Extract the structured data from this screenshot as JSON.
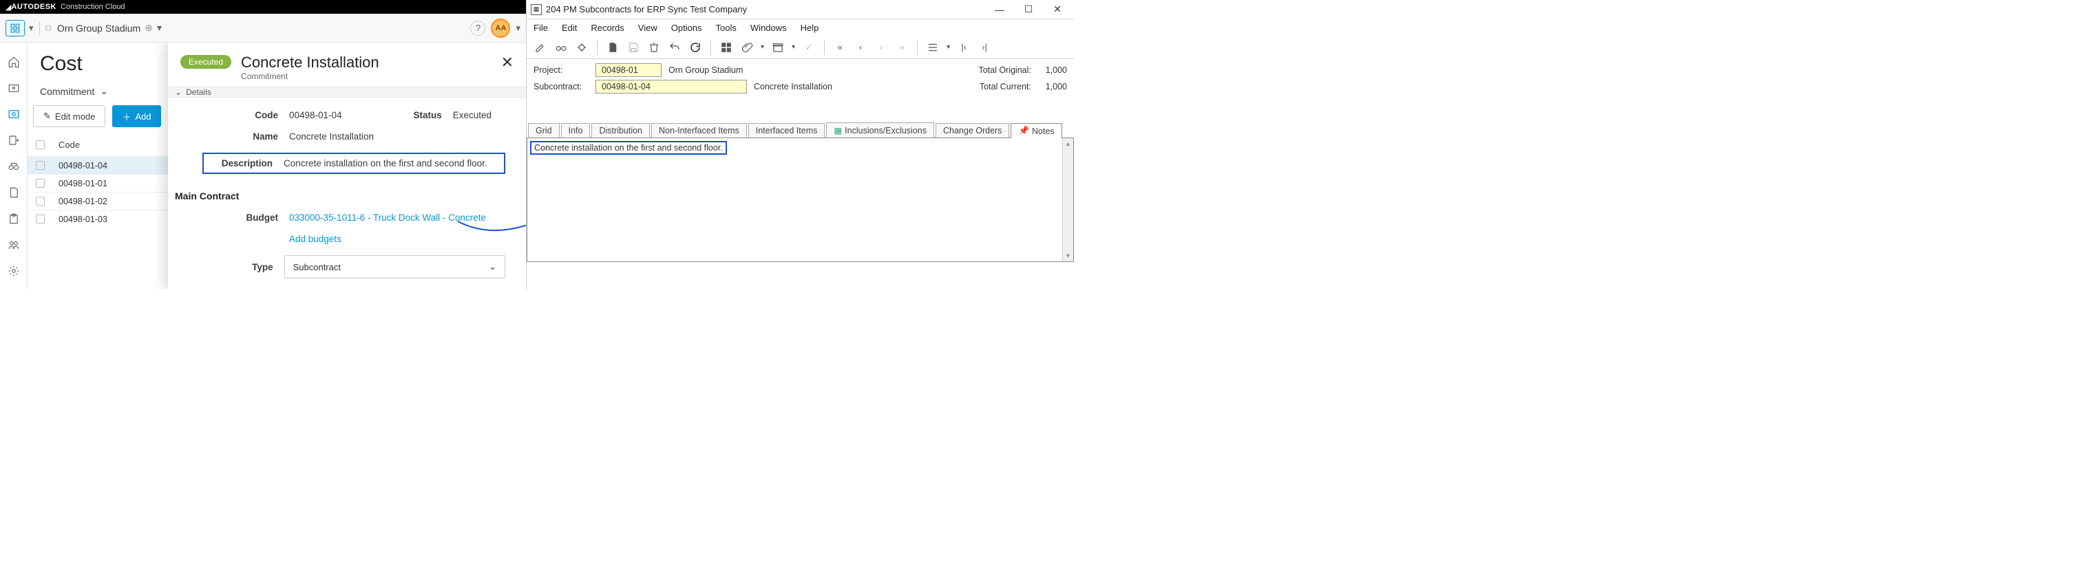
{
  "acc": {
    "brand": "AUTODESK",
    "product": "Construction Cloud",
    "project_name": "Orn Group Stadium",
    "avatar": "AA",
    "help": "?",
    "page_title": "Cost",
    "tab_label": "Commitment",
    "edit_btn": "Edit mode",
    "add_btn": "Add",
    "col_code": "Code",
    "rows": [
      {
        "code": "00498-01-04",
        "selected": true
      },
      {
        "code": "00498-01-01",
        "selected": false
      },
      {
        "code": "00498-01-02",
        "selected": false
      },
      {
        "code": "00498-01-03",
        "selected": false
      }
    ]
  },
  "panel": {
    "badge": "Executed",
    "title": "Concrete Installation",
    "subtitle": "Commitment",
    "acc_label": "Details",
    "lbl_code": "Code",
    "val_code": "00498-01-04",
    "lbl_status": "Status",
    "val_status": "Executed",
    "lbl_name": "Name",
    "val_name": "Concrete Installation",
    "lbl_desc": "Description",
    "val_desc": "Concrete installation on the first and second floor.",
    "section_main": "Main Contract",
    "lbl_budget": "Budget",
    "val_budget": "033000-35-1011-6 - Truck Dock Wall - Concrete",
    "add_budgets": "Add budgets",
    "lbl_type": "Type",
    "val_type": "Subcontract"
  },
  "erp": {
    "title": "204 PM Subcontracts for ERP Sync Test Company",
    "menu": [
      "File",
      "Edit",
      "Records",
      "View",
      "Options",
      "Tools",
      "Windows",
      "Help"
    ],
    "lbl_project": "Project:",
    "val_project_id": "00498-01",
    "val_project_name": "Orn Group Stadium",
    "lbl_sub": "Subcontract:",
    "val_sub_id": "00498-01-04",
    "val_sub_name": "Concrete Installation",
    "lbl_total_orig": "Total Original:",
    "val_total_orig": "1,000",
    "lbl_total_cur": "Total Current:",
    "val_total_cur": "1,000",
    "tabs": [
      "Grid",
      "Info",
      "Distribution",
      "Non-Interfaced Items",
      "Interfaced Items",
      "Inclusions/Exclusions",
      "Change Orders",
      "Notes"
    ],
    "notes_text": "Concrete installation on the first and second floor."
  }
}
